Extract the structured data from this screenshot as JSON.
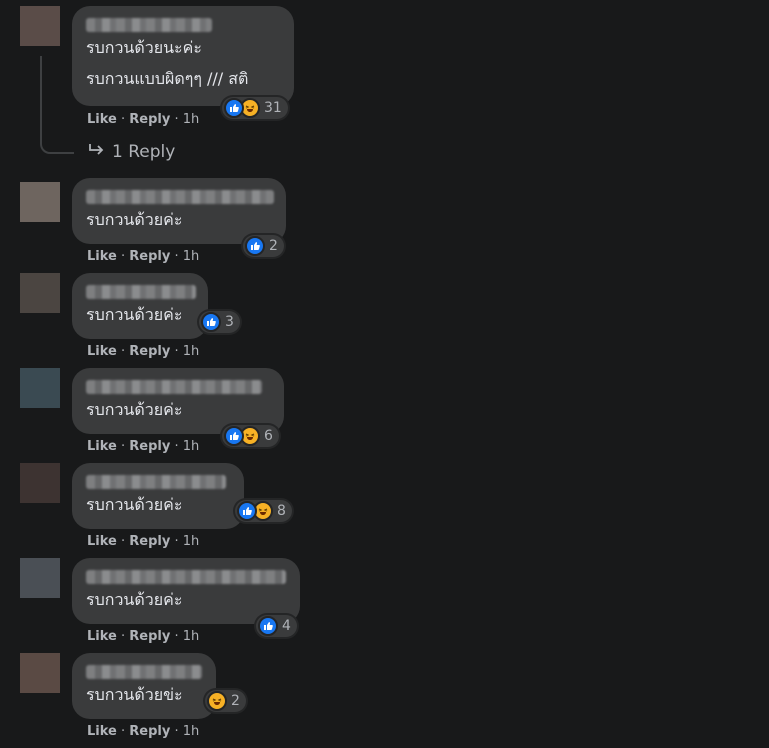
{
  "comments": [
    {
      "lines": [
        "รบกวนด้วยนะค่ะ",
        "รบกวนแบบผิดๆๆ /// สติ"
      ],
      "reactions": [
        "like",
        "haha"
      ],
      "count": "31",
      "like": "Like",
      "reply": "Reply",
      "time": "1h",
      "replies": "1 Reply"
    },
    {
      "lines": [
        "รบกวนด้วยค่ะ"
      ],
      "reactions": [
        "like"
      ],
      "count": "2",
      "like": "Like",
      "reply": "Reply",
      "time": "1h"
    },
    {
      "lines": [
        "รบกวนด้วยค่ะ"
      ],
      "reactions": [
        "like"
      ],
      "count": "3",
      "like": "Like",
      "reply": "Reply",
      "time": "1h"
    },
    {
      "lines": [
        "รบกวนด้วยค่ะ"
      ],
      "reactions": [
        "like",
        "haha"
      ],
      "count": "6",
      "like": "Like",
      "reply": "Reply",
      "time": "1h"
    },
    {
      "lines": [
        "รบกวนด้วยค่ะ"
      ],
      "reactions": [
        "like",
        "haha"
      ],
      "count": "8",
      "like": "Like",
      "reply": "Reply",
      "time": "1h"
    },
    {
      "lines": [
        "รบกวนด้วยค่ะ"
      ],
      "reactions": [
        "like"
      ],
      "count": "4",
      "like": "Like",
      "reply": "Reply",
      "time": "1h"
    },
    {
      "lines": [
        "รบกวนด้วยข่ะ"
      ],
      "reactions": [
        "haha"
      ],
      "count": "2",
      "like": "Like",
      "reply": "Reply",
      "time": "1h"
    }
  ],
  "icons": {
    "like": "like-reaction-icon",
    "haha": "haha-reaction-icon",
    "reply_arrow": "reply-arrow-icon"
  },
  "colors": {
    "background": "#18191a",
    "bubble": "#3a3b3c",
    "like_blue": "#1877f2",
    "haha_yellow": "#f7b125"
  }
}
